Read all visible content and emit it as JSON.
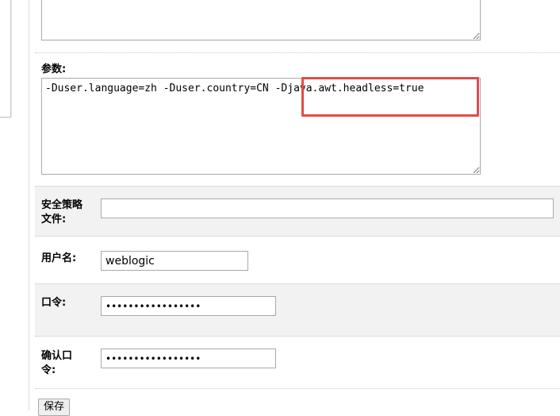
{
  "form": {
    "args_label": "参数:",
    "args_value": "-Duser.language=zh -Duser.country=CN -Djava.awt.headless=true",
    "policy_label_line1": "安全策略",
    "policy_label_line2": "文件:",
    "policy_value": "",
    "username_label": "用户名:",
    "username_value": "weblogic",
    "password_label": "口令:",
    "password_value": "weblogic123456789",
    "confirm_label_line1": "确认口",
    "confirm_label_line2": "令:",
    "confirm_value": "weblogic123456789",
    "save_label": "保存"
  },
  "colors": {
    "highlight_border": "#e34b4b",
    "row_shade": "#f2f2f2"
  }
}
